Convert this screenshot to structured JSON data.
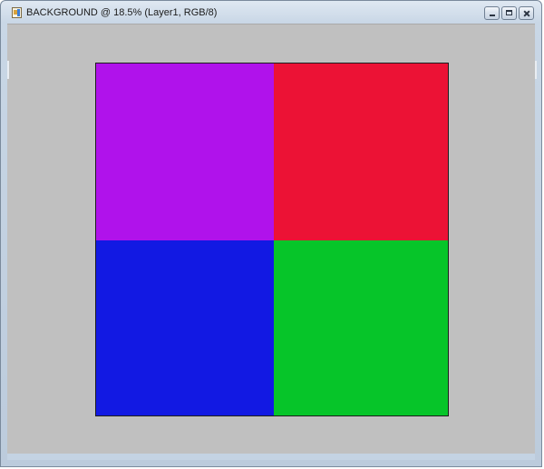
{
  "window": {
    "title": "BACKGROUND @ 18.5% (Layer1, RGB/8)",
    "icon": "photoshop-document-icon",
    "buttons": {
      "minimize_icon": "minimize-icon",
      "maximize_icon": "maximize-icon",
      "close_icon": "close-icon"
    }
  },
  "canvas": {
    "background_color": "#c0c0c0",
    "quadrants": [
      {
        "name": "top-left",
        "color": "#b012eb"
      },
      {
        "name": "top-right",
        "color": "#ec1235"
      },
      {
        "name": "bottom-left",
        "color": "#1219e3"
      },
      {
        "name": "bottom-right",
        "color": "#06c529"
      }
    ]
  }
}
